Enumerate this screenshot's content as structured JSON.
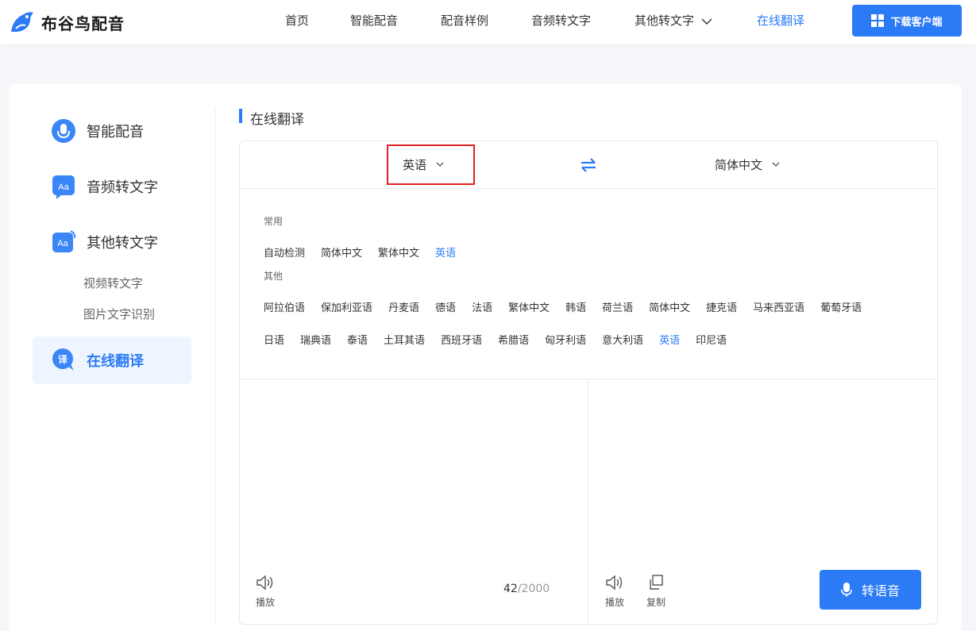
{
  "brand": {
    "name": "布谷鸟配音",
    "accent": "#2b7bf6"
  },
  "nav": {
    "items": [
      "首页",
      "智能配音",
      "配音样例",
      "音频转文字",
      "其他转文字",
      "在线翻译"
    ],
    "active": "在线翻译",
    "download_label": "下载客户端"
  },
  "sidebar": {
    "items": [
      {
        "label": "智能配音",
        "icon": "microphone-icon"
      },
      {
        "label": "音频转文字",
        "icon": "aa-text-icon"
      },
      {
        "label": "其他转文字",
        "icon": "aa-text-icon"
      },
      {
        "label": "在线翻译",
        "icon": "translate-icon"
      }
    ],
    "subitems": [
      "视频转文字",
      "图片文字识别"
    ],
    "active": "在线翻译"
  },
  "section_title": "在线翻译",
  "translator": {
    "source_lang": "英语",
    "target_lang": "简体中文",
    "common_label": "常用",
    "common_langs": [
      "自动检测",
      "简体中文",
      "繁体中文",
      "英语"
    ],
    "other_label": "其他",
    "other_langs_row1": [
      "阿拉伯语",
      "保加利亚语",
      "丹麦语",
      "德语",
      "法语",
      "繁体中文",
      "韩语",
      "荷兰语",
      "简体中文",
      "捷克语",
      "马来西亚语",
      "葡萄牙语"
    ],
    "other_langs_row2": [
      "日语",
      "瑞典语",
      "泰语",
      "土耳其语",
      "西班牙语",
      "希腊语",
      "匈牙利语",
      "意大利语",
      "英语",
      "印尼语"
    ],
    "selected_lang": "英语",
    "play_label": "播放",
    "copy_label": "复制",
    "char_current": "42",
    "char_max": "/2000",
    "speak_label": "转语音"
  }
}
